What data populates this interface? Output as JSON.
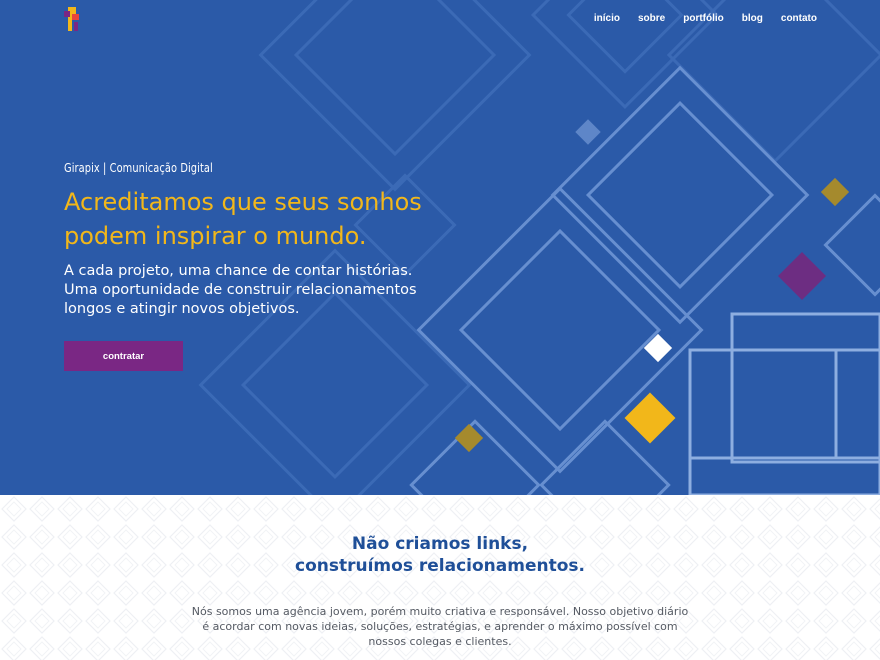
{
  "brand": {
    "logo_icon": "girapix-logo-icon",
    "colors": {
      "hero_bg": "#2b5aa8",
      "accent_yellow": "#f2b71a",
      "accent_purple": "#7a2784",
      "heading_blue": "#1f4f98"
    }
  },
  "nav": {
    "items": [
      "início",
      "sobre",
      "portfólio",
      "blog",
      "contato"
    ]
  },
  "hero": {
    "tagline": "Girapix | Comunicação Digital",
    "headline_line1": "Acreditamos que seus sonhos",
    "headline_line2": "podem inspirar o mundo.",
    "subtitle": "A cada projeto, uma chance de contar histórias. Uma oportunidade de construir relacionamentos longos e atingir novos objetivos.",
    "cta_label": "contratar"
  },
  "about": {
    "heading_line1": "Não criamos links,",
    "heading_line2": "construímos relacionamentos.",
    "text": "Nós somos uma agência jovem, porém muito criativa e responsável. Nosso objetivo diário é acordar com novas ideias, soluções, estratégias, e aprender o máximo possível com nossos colegas e clientes."
  }
}
